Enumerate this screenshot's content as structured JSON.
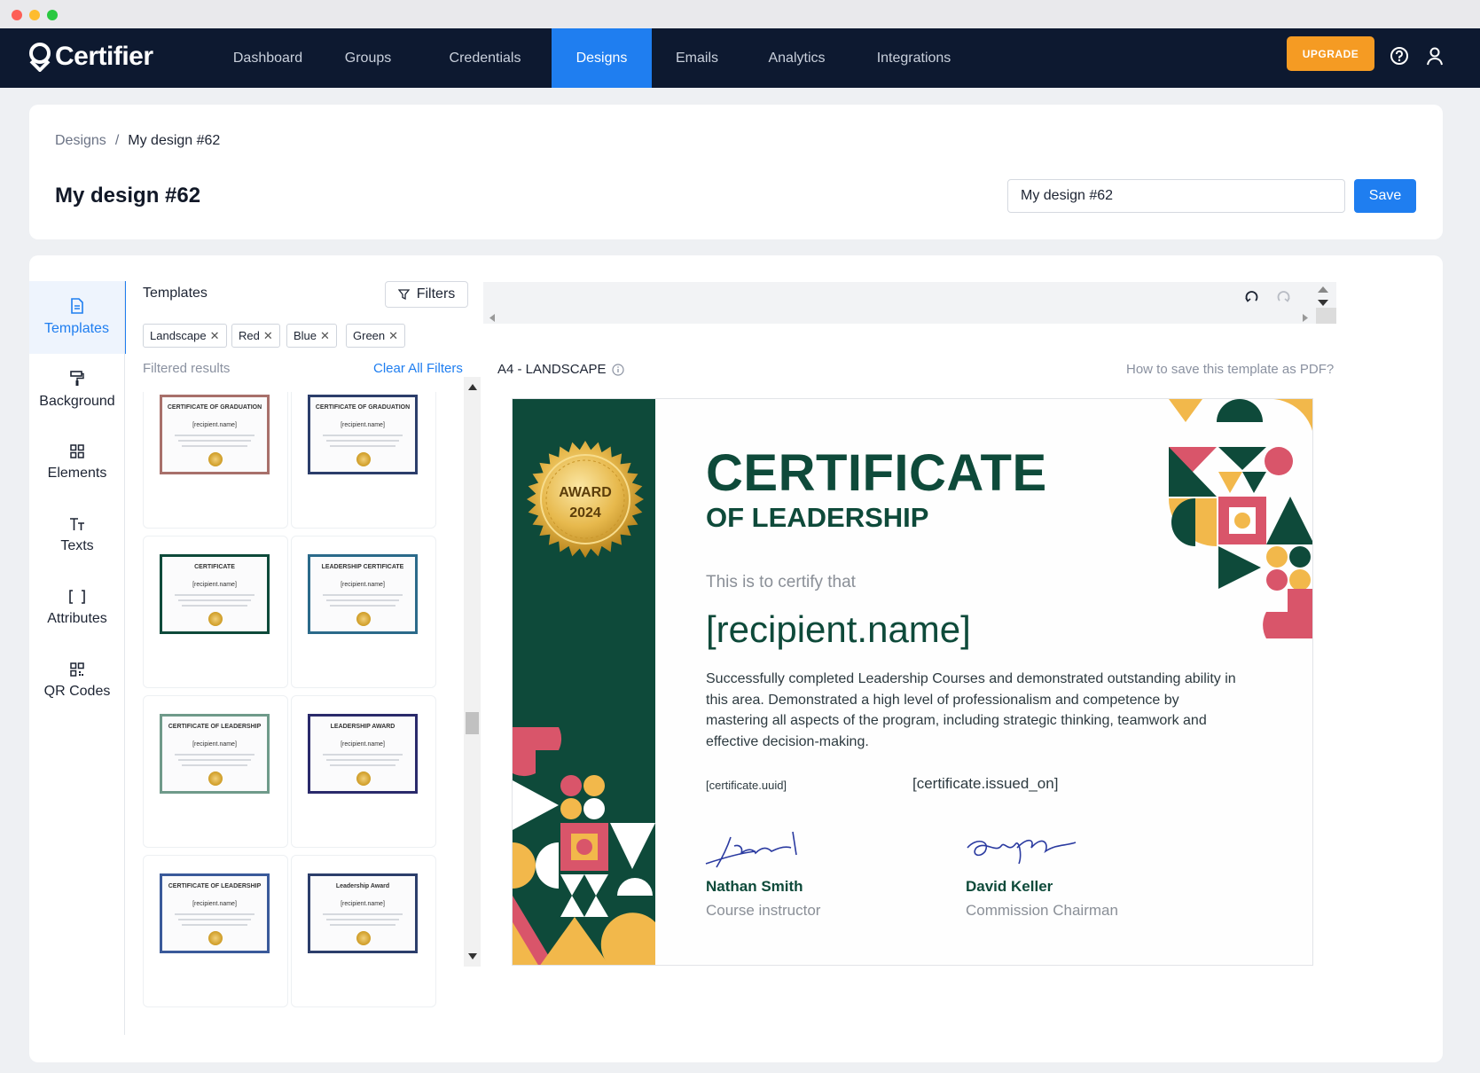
{
  "app": {
    "brand": "Certifier",
    "nav": [
      "Dashboard",
      "Groups",
      "Credentials",
      "Designs",
      "Emails",
      "Analytics",
      "Integrations"
    ],
    "active_nav": "Designs",
    "upgrade_label": "UPGRADE"
  },
  "header": {
    "breadcrumb_root": "Designs",
    "breadcrumb_sep": "/",
    "breadcrumb_current": "My design #62",
    "title": "My design #62",
    "name_value": "My design #62",
    "save_label": "Save"
  },
  "sidebar": {
    "items": [
      {
        "label": "Templates",
        "icon": "document-icon"
      },
      {
        "label": "Background",
        "icon": "paint-roller-icon"
      },
      {
        "label": "Elements",
        "icon": "grid-icon"
      },
      {
        "label": "Texts",
        "icon": "text-icon"
      },
      {
        "label": "Attributes",
        "icon": "brackets-icon"
      },
      {
        "label": "QR Codes",
        "icon": "qr-code-icon"
      }
    ]
  },
  "templates": {
    "title": "Templates",
    "filters_label": "Filters",
    "chips": [
      "Landscape",
      "Red",
      "Blue",
      "Green"
    ],
    "filtered_label": "Filtered results",
    "clear_label": "Clear All Filters",
    "thumbs": [
      {
        "title": "CERTIFICATE OF GRADUATION",
        "name": "[recipient.name]",
        "border": "#a8706b"
      },
      {
        "title": "CERTIFICATE OF GRADUATION",
        "name": "[recipient.name]",
        "border": "#2c3e6b"
      },
      {
        "title": "CERTIFICATE",
        "name": "[recipient.name]",
        "border": "#0e4a3a"
      },
      {
        "title": "LEADERSHIP CERTIFICATE",
        "name": "[recipient.name]",
        "border": "#2b6a8a"
      },
      {
        "title": "CERTIFICATE OF LEADERSHIP",
        "name": "[recipient.name]",
        "border": "#6f9a8a"
      },
      {
        "title": "LEADERSHIP AWARD",
        "name": "[recipient.name]",
        "border": "#2a2a6b"
      },
      {
        "title": "CERTIFICATE OF LEADERSHIP",
        "name": "[recipient.name]",
        "border": "#3a5a9a"
      },
      {
        "title": "Leadership Award",
        "name": "[recipient.name]",
        "border": "#2c3e6b"
      }
    ]
  },
  "editor": {
    "format_label": "A4 - LANDSCAPE",
    "howto_label": "How to save this template as PDF?"
  },
  "certificate": {
    "seal_line1": "AWARD",
    "seal_line2": "2024",
    "title": "CERTIFICATE",
    "subtitle": "OF LEADERSHIP",
    "certify": "This is to certify that",
    "recipient": "[recipient.name]",
    "body": "Successfully completed Leadership Courses and demonstrated outstanding ability in this area. Demonstrated a high level of professionalism and competence by mastering all aspects of the program, including strategic thinking, teamwork and effective decision-making.",
    "uuid": "[certificate.uuid]",
    "issued": "[certificate.issued_on]",
    "signer1_name": "Nathan Smith",
    "signer1_role": "Course instructor",
    "signer2_name": "David Keller",
    "signer2_role": "Commission Chairman"
  },
  "colors": {
    "nav_bg": "#0d1930",
    "accent": "#1f7ef0",
    "upgrade": "#f59b23",
    "cert_green": "#0e4a3a",
    "cert_pink": "#d9556a",
    "cert_yellow": "#f2b84b"
  }
}
